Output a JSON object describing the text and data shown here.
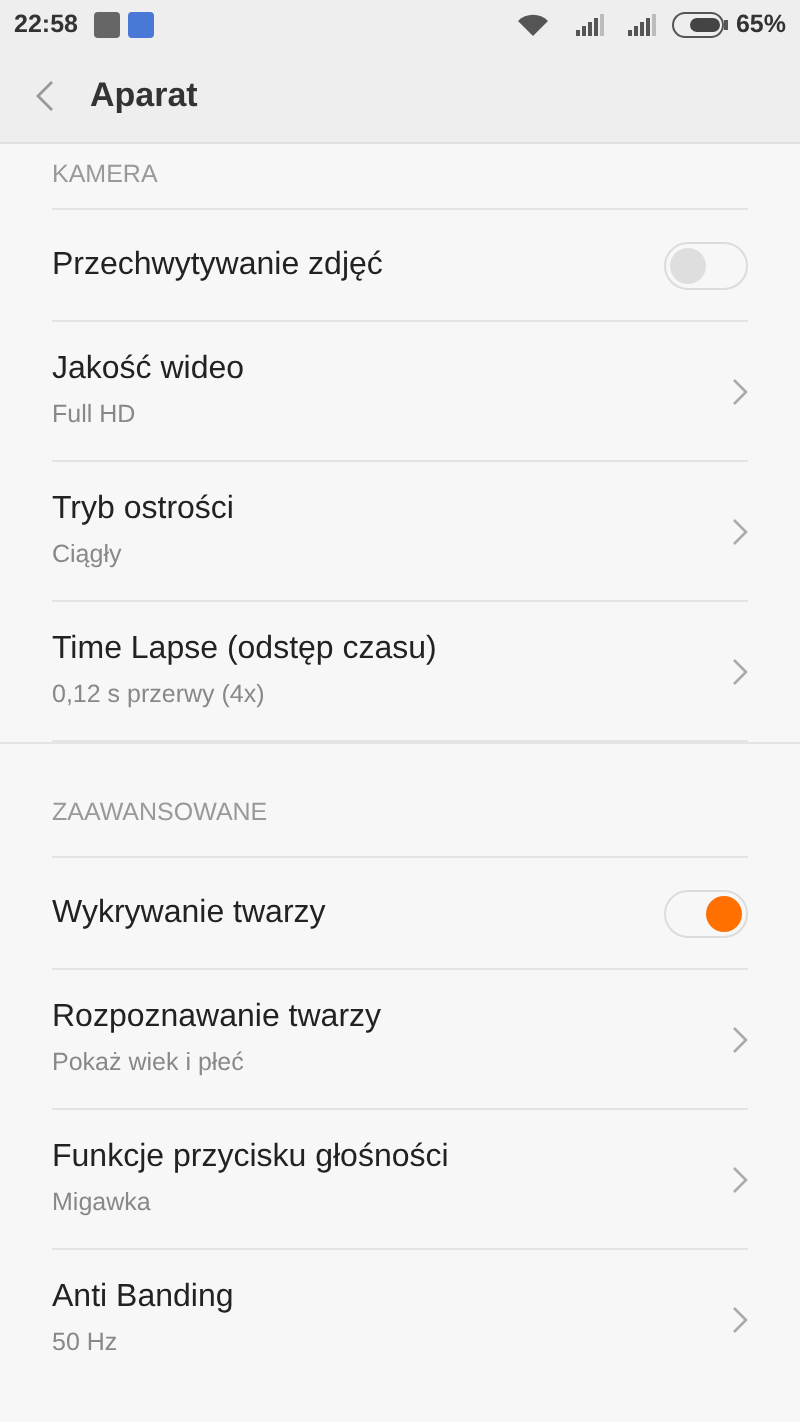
{
  "status_bar": {
    "time": "22:58",
    "battery": "65%"
  },
  "header": {
    "title": "Aparat"
  },
  "sections": [
    {
      "title": "KAMERA",
      "items": [
        {
          "kind": "toggle",
          "title": "Przechwytywanie zdjęć",
          "on": false
        },
        {
          "kind": "link",
          "title": "Jakość wideo",
          "value": "Full HD"
        },
        {
          "kind": "link",
          "title": "Tryb ostrości",
          "value": "Ciągły"
        },
        {
          "kind": "link",
          "title": "Time Lapse (odstęp czasu)",
          "value": "0,12 s przerwy (4x)"
        }
      ]
    },
    {
      "title": "ZAAWANSOWANE",
      "items": [
        {
          "kind": "toggle",
          "title": "Wykrywanie twarzy",
          "on": true
        },
        {
          "kind": "link",
          "title": "Rozpoznawanie twarzy",
          "value": "Pokaż wiek i płeć"
        },
        {
          "kind": "link",
          "title": "Funkcje przycisku głośności",
          "value": "Migawka"
        },
        {
          "kind": "link",
          "title": "Anti Banding",
          "value": "50 Hz"
        }
      ]
    }
  ]
}
